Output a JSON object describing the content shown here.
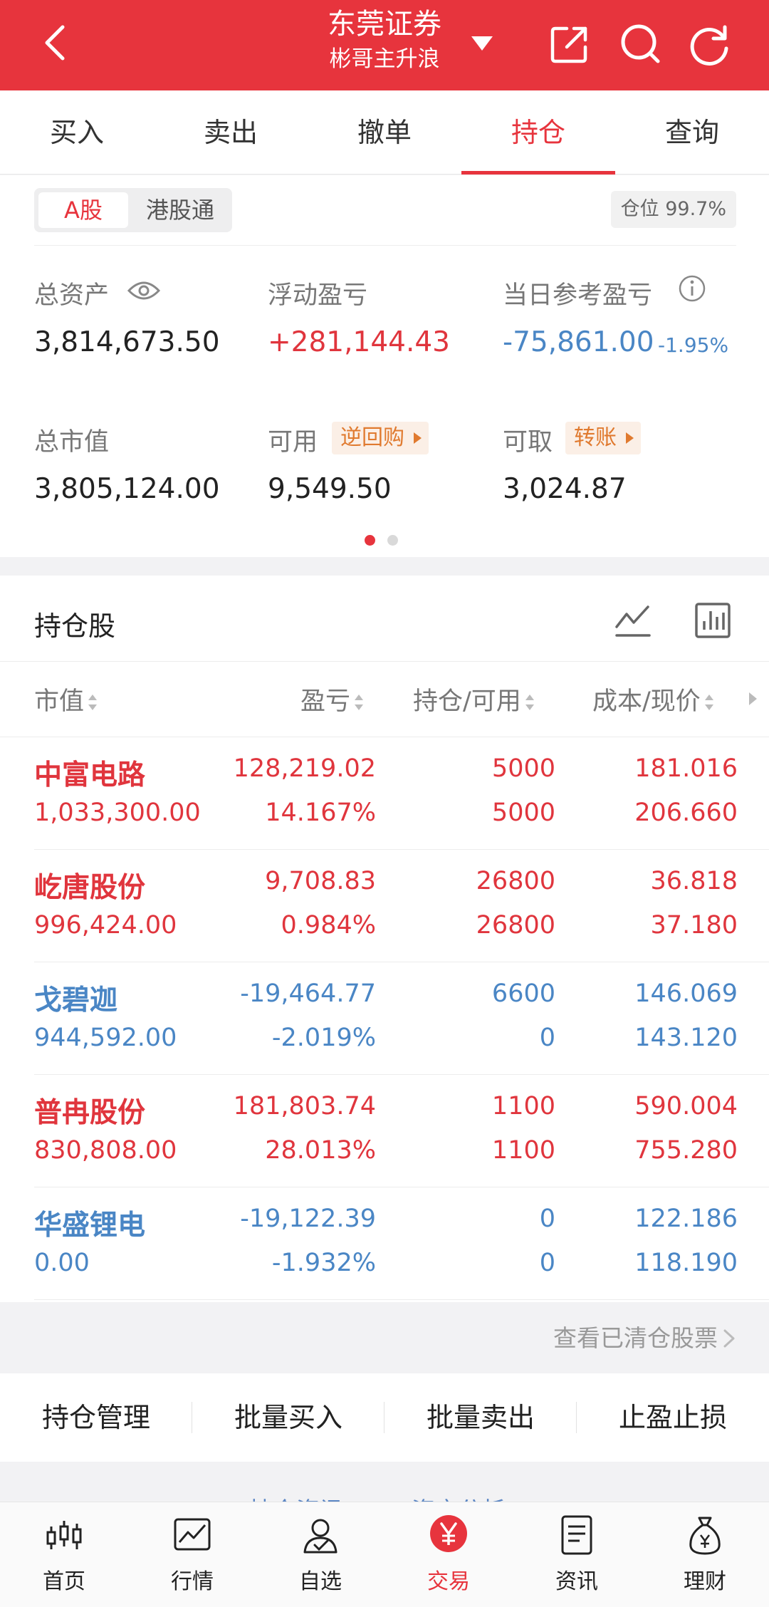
{
  "header": {
    "title": "东莞证券",
    "subtitle": "彬哥主升浪",
    "icons": [
      "back-icon",
      "dropdown-icon",
      "share-icon",
      "search-icon",
      "refresh-icon"
    ]
  },
  "tabs": [
    {
      "label": "买入"
    },
    {
      "label": "卖出"
    },
    {
      "label": "撤单"
    },
    {
      "label": "持仓",
      "active": true
    },
    {
      "label": "查询"
    }
  ],
  "summary": {
    "segments": [
      "A股",
      "港股通"
    ],
    "position_ratio": "仓位 99.7%",
    "total_assets_label": "总资产",
    "total_assets": "3,814,673.50",
    "floating_pl_label": "浮动盈亏",
    "floating_pl": "+281,144.43",
    "daily_pl_label": "当日参考盈亏",
    "daily_pl": "-75,861.00",
    "daily_pl_pct": "-1.95%",
    "market_value_label": "总市值",
    "market_value": "3,805,124.00",
    "available_label": "可用",
    "reverse_repo": "逆回购",
    "available": "9,549.50",
    "withdrawable_label": "可取",
    "transfer": "转账",
    "withdrawable": "3,024.87"
  },
  "holdings": {
    "title": "持仓股",
    "columns": [
      "市值",
      "盈亏",
      "持仓/可用",
      "成本/现价"
    ],
    "rows": [
      {
        "name": "中富电路",
        "market_value": "1,033,300.00",
        "pl": "128,219.02",
        "pl_pct": "14.167%",
        "position": "5000",
        "available": "5000",
        "cost": "181.016",
        "price": "206.660",
        "trend": "up"
      },
      {
        "name": "屹唐股份",
        "market_value": "996,424.00",
        "pl": "9,708.83",
        "pl_pct": "0.984%",
        "position": "26800",
        "available": "26800",
        "cost": "36.818",
        "price": "37.180",
        "trend": "up"
      },
      {
        "name": "戈碧迦",
        "market_value": "944,592.00",
        "pl": "-19,464.77",
        "pl_pct": "-2.019%",
        "position": "6600",
        "available": "0",
        "cost": "146.069",
        "price": "143.120",
        "trend": "down"
      },
      {
        "name": "普冉股份",
        "market_value": "830,808.00",
        "pl": "181,803.74",
        "pl_pct": "28.013%",
        "position": "1100",
        "available": "1100",
        "cost": "590.004",
        "price": "755.280",
        "trend": "up"
      },
      {
        "name": "华盛锂电",
        "market_value": "0.00",
        "pl": "-19,122.39",
        "pl_pct": "-1.932%",
        "position": "0",
        "available": "0",
        "cost": "122.186",
        "price": "118.190",
        "trend": "down"
      }
    ],
    "cleared_link": "查看已清仓股票"
  },
  "actions": [
    "持仓管理",
    "批量买入",
    "批量卖出",
    "止盈止损"
  ],
  "peek": [
    "持仓资讯",
    "资产分析"
  ],
  "bottom_nav": [
    {
      "label": "首页",
      "icon": "candlestick-icon"
    },
    {
      "label": "行情",
      "icon": "trend-chart-icon"
    },
    {
      "label": "自选",
      "icon": "user-check-icon"
    },
    {
      "label": "交易",
      "icon": "yen-icon",
      "active": true
    },
    {
      "label": "资讯",
      "icon": "document-icon"
    },
    {
      "label": "理财",
      "icon": "money-bag-icon"
    }
  ],
  "colors": {
    "brand_red": "#e7343d",
    "down_blue": "#4a86c5",
    "accent_orange": "#e07a2f"
  }
}
